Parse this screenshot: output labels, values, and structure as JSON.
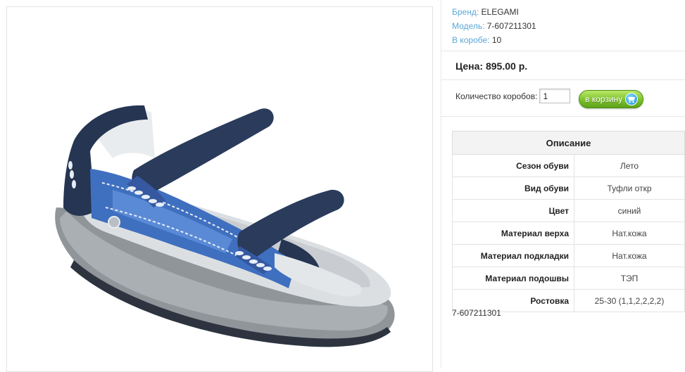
{
  "product": {
    "brand_label": "Бренд:",
    "brand": "ELEGAMI",
    "model_label": "Модель:",
    "model": "7-607211301",
    "box_label": "В коробе:",
    "box_count": "10"
  },
  "price": {
    "text": "Цена: 895.00 р."
  },
  "order": {
    "qty_label": "Количество коробов:",
    "qty_value": "1",
    "cart_button": "в корзину"
  },
  "description": {
    "title": "Описание",
    "rows": [
      {
        "key": "Сезон обуви",
        "value": "Лето"
      },
      {
        "key": "Вид обуви",
        "value": "Туфли откр"
      },
      {
        "key": "Цвет",
        "value": "синий"
      },
      {
        "key": "Материал верха",
        "value": "Нат.кожа"
      },
      {
        "key": "Материал подкладки",
        "value": "Нат.кожа"
      },
      {
        "key": "Материал подошвы",
        "value": "ТЭП"
      },
      {
        "key": "Ростовка",
        "value": "25-30 (1,1,2,2,2,2)"
      }
    ]
  },
  "article_code": "7-607211301",
  "colors": {
    "label_blue": "#5aa7d8",
    "cart_green": "#7cc22b"
  },
  "image": {
    "subject": "blue children's sandal with two velcro straps",
    "icon": "sandal-photo"
  }
}
